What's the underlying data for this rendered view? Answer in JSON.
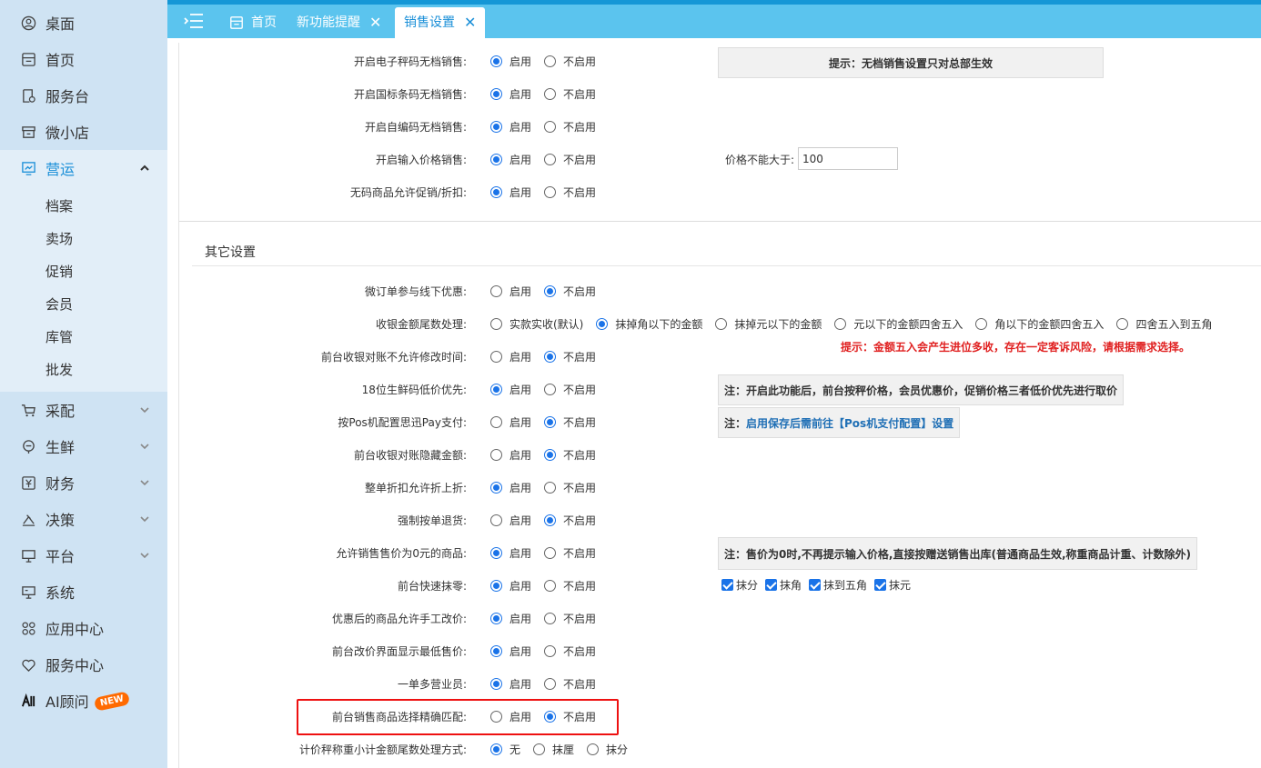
{
  "sidebar": {
    "items": [
      {
        "label": "桌面",
        "icon": "desktop-icon"
      },
      {
        "label": "首页",
        "icon": "home-icon"
      },
      {
        "label": "服务台",
        "icon": "service-desk-icon"
      },
      {
        "label": "微小店",
        "icon": "shop-icon"
      },
      {
        "label": "营运",
        "icon": "operation-icon",
        "active": true
      },
      {
        "label": "采配",
        "icon": "cart-icon"
      },
      {
        "label": "生鲜",
        "icon": "fresh-icon"
      },
      {
        "label": "财务",
        "icon": "finance-icon"
      },
      {
        "label": "决策",
        "icon": "decision-icon"
      },
      {
        "label": "平台",
        "icon": "platform-icon"
      },
      {
        "label": "系统",
        "icon": "system-icon"
      },
      {
        "label": "应用中心",
        "icon": "apps-icon"
      },
      {
        "label": "服务中心",
        "icon": "support-icon"
      },
      {
        "label": "AI顾问",
        "icon": "ai-icon",
        "badge": "NEW"
      }
    ],
    "sub_items": [
      "档案",
      "卖场",
      "促销",
      "会员",
      "库管",
      "批发"
    ]
  },
  "tabs": [
    {
      "label": "首页"
    },
    {
      "label": "新功能提醒"
    },
    {
      "label": "销售设置",
      "active": true
    }
  ],
  "radio_labels": {
    "on": "启用",
    "off": "不启用"
  },
  "top_rows": [
    {
      "label": "开启电子秤码无档销售:",
      "value": "on"
    },
    {
      "label": "开启国标条码无档销售:",
      "value": "on"
    },
    {
      "label": "开启自编码无档销售:",
      "value": "on"
    },
    {
      "label": "开启输入价格销售:",
      "value": "on"
    },
    {
      "label": "无码商品允许促销/折扣:",
      "value": "on"
    }
  ],
  "top_tip": "提示：无档销售设置只对总部生效",
  "price_limit": {
    "label": "价格不能大于:",
    "value": "100"
  },
  "section_title": "其它设置",
  "other_rows": [
    {
      "label": "微订单参与线下优惠:",
      "value": "off"
    },
    {
      "label": "收银金额尾数处理:",
      "value": "special"
    },
    {
      "label": "前台收银对账不允许修改时间:",
      "value": "off"
    },
    {
      "label": "18位生鲜码低价优先:",
      "value": "on"
    },
    {
      "label": "按Pos机配置思迅Pay支付:",
      "value": "off"
    },
    {
      "label": "前台收银对账隐藏金额:",
      "value": "off"
    },
    {
      "label": "整单折扣允许折上折:",
      "value": "on"
    },
    {
      "label": "强制按单退货:",
      "value": "off"
    },
    {
      "label": "允许销售售价为0元的商品:",
      "value": "on"
    },
    {
      "label": "前台快速抹零:",
      "value": "on"
    },
    {
      "label": "优惠后的商品允许手工改价:",
      "value": "on"
    },
    {
      "label": "前台改价界面显示最低售价:",
      "value": "on"
    },
    {
      "label": "一单多营业员:",
      "value": "on"
    },
    {
      "label": "前台销售商品选择精确匹配:",
      "value": "off"
    }
  ],
  "rounding_options": [
    "实款实收(默认)",
    "抹掉角以下的金额",
    "抹掉元以下的金额",
    "元以下的金额四舍五入",
    "角以下的金额四舍五入",
    "四舍五入到五角"
  ],
  "rounding_selected": 1,
  "rounding_tip": "提示：金额五入会产生进位多收，存在一定客诉风险，请根据需求选择。",
  "note_fresh": "注：开启此功能后，前台按秤价格，会员优惠价，促销价格三者低价优先进行取价",
  "note_pay_prefix": "注：",
  "note_pay_link": "启用保存后需前往【Pos机支付配置】设置",
  "note_zero": "注：售价为0时,不再提示输入价格,直接按赠送销售出库(普通商品生效,称重商品计重、计数除外)",
  "zero_checks": [
    "抹分",
    "抹角",
    "抹到五角",
    "抹元"
  ],
  "last_row": {
    "label": "计价秤称重小计金额尾数处理方式:",
    "options": [
      "无",
      "抹厘",
      "抹分"
    ],
    "selected": 0
  },
  "colors": {
    "sidebar_bg": "#cfe3f3",
    "topbar_bg": "#5bc4ee",
    "accent": "#1a8fd8",
    "warning": "#e02020"
  }
}
